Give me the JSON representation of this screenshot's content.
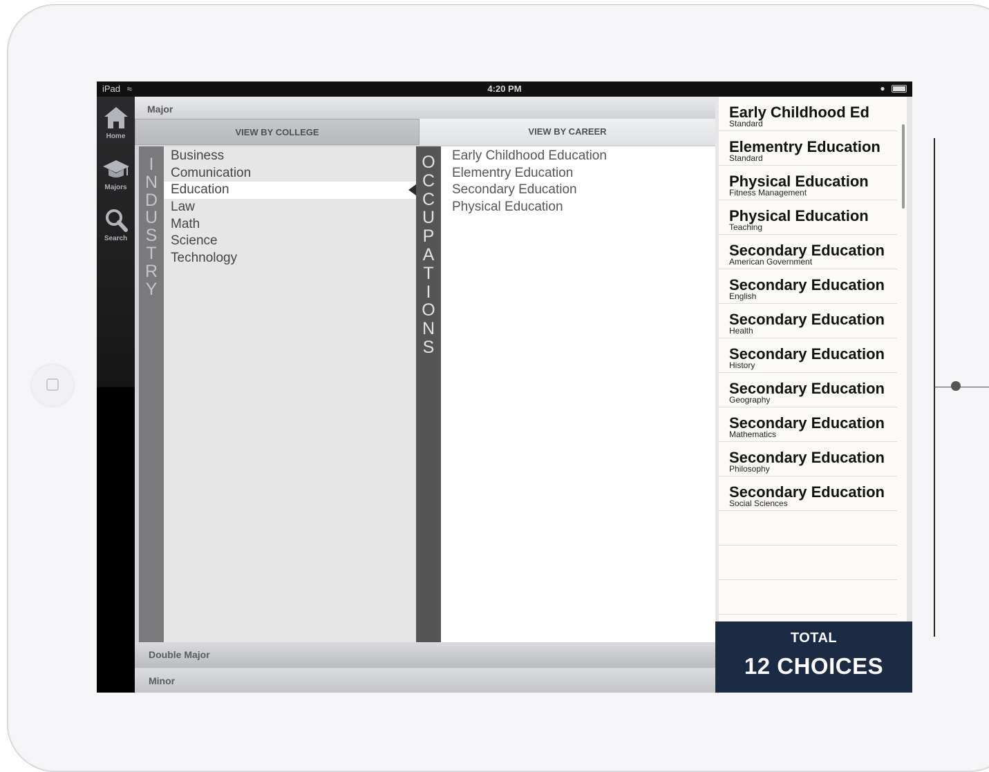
{
  "status_bar": {
    "device": "iPad",
    "time": "4:20 PM"
  },
  "nav": {
    "items": [
      {
        "label": "Home",
        "icon": "home-icon"
      },
      {
        "label": "Majors",
        "icon": "graduation-cap-icon"
      },
      {
        "label": "Search",
        "icon": "search-icon"
      }
    ]
  },
  "panel": {
    "major_label": "Major",
    "tabs": [
      {
        "label": "VIEW BY COLLEGE",
        "selected": true
      },
      {
        "label": "VIEW BY CAREER",
        "selected": false
      }
    ],
    "industry_vertical_label": "INDUSTRY",
    "occupations_vertical_label": "OCCUPATIONS",
    "industries": [
      "Business",
      "Comunication",
      "Education",
      "Law",
      "Math",
      "Science",
      "Technology"
    ],
    "selected_industry": "Education",
    "occupations": [
      "Early Childhood Education",
      "Elementry Education",
      "Secondary Education",
      "Physical Education"
    ],
    "double_major_label": "Double Major",
    "minor_label": "Minor"
  },
  "choices": {
    "items": [
      {
        "title": "Early Childhood Ed",
        "subtitle": "Standard"
      },
      {
        "title": "Elementry Education",
        "subtitle": "Standard"
      },
      {
        "title": "Physical Education",
        "subtitle": "Fitness Management"
      },
      {
        "title": "Physical Education",
        "subtitle": "Teaching"
      },
      {
        "title": "Secondary Education",
        "subtitle": "American Government"
      },
      {
        "title": "Secondary Education",
        "subtitle": "English"
      },
      {
        "title": "Secondary Education",
        "subtitle": "Health"
      },
      {
        "title": "Secondary Education",
        "subtitle": "History"
      },
      {
        "title": "Secondary Education",
        "subtitle": "Geography"
      },
      {
        "title": "Secondary Education",
        "subtitle": "Mathematics"
      },
      {
        "title": "Secondary Education",
        "subtitle": "Philosophy"
      },
      {
        "title": "Secondary Education",
        "subtitle": "Social Sciences"
      }
    ],
    "total_label": "TOTAL",
    "total_count": "12 CHOICES"
  },
  "colors": {
    "total_bg": "#1b2b43",
    "strip_industry": "#7a7a7c",
    "strip_occupations": "#555556"
  }
}
